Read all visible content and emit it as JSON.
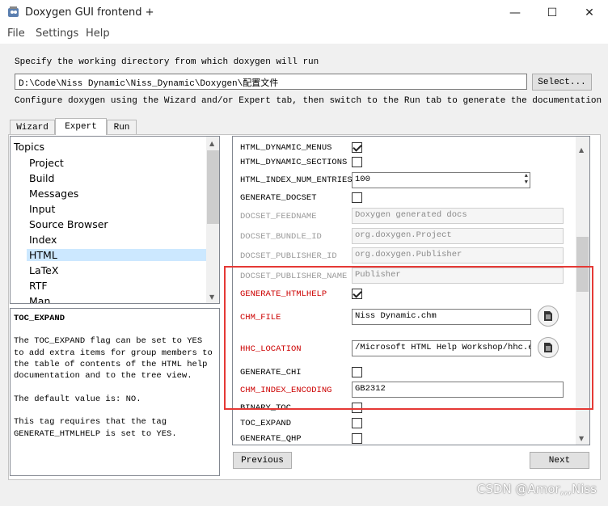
{
  "window": {
    "title": "Doxygen GUI frontend +",
    "minimize_glyph": "—",
    "maximize_glyph": "☐",
    "close_glyph": "✕"
  },
  "menu": [
    "File",
    "Settings",
    "Help"
  ],
  "workdir": {
    "label": "Specify the working directory from which doxygen will run",
    "path": "D:\\Code\\Niss Dynamic\\Niss_Dynamic\\Doxygen\\配置文件",
    "select_label": "Select..."
  },
  "configure_hint": "Configure doxygen using the Wizard and/or Expert tab, then switch to the Run tab to generate the documentation",
  "tabs": [
    "Wizard",
    "Expert",
    "Run"
  ],
  "topics": {
    "header": "Topics",
    "items": [
      "Project",
      "Build",
      "Messages",
      "Input",
      "Source Browser",
      "Index",
      "HTML",
      "LaTeX",
      "RTF",
      "Man"
    ],
    "selected": "HTML"
  },
  "help": {
    "title": "TOC_EXPAND",
    "body": "The TOC_EXPAND flag can be set to YES\nto add extra items for group members to\nthe table of contents of the HTML help\ndocumentation and to the tree view.\n\nThe default value is: NO.\n\nThis tag requires that the tag\nGENERATE_HTMLHELP is set to YES."
  },
  "settings": {
    "html_dynamic_menus": {
      "label": "HTML_DYNAMIC_MENUS",
      "checked": true
    },
    "html_dynamic_sections": {
      "label": "HTML_DYNAMIC_SECTIONS",
      "checked": false
    },
    "html_index_num_entries": {
      "label": "HTML_INDEX_NUM_ENTRIES",
      "value": "100"
    },
    "generate_docset": {
      "label": "GENERATE_DOCSET",
      "checked": false
    },
    "docset_feedname": {
      "label": "DOCSET_FEEDNAME",
      "value": "Doxygen generated docs"
    },
    "docset_bundle_id": {
      "label": "DOCSET_BUNDLE_ID",
      "value": "org.doxygen.Project"
    },
    "docset_publisher_id": {
      "label": "DOCSET_PUBLISHER_ID",
      "value": "org.doxygen.Publisher"
    },
    "docset_publisher_name": {
      "label": "DOCSET_PUBLISHER_NAME",
      "value": "Publisher"
    },
    "generate_htmlhelp": {
      "label": "GENERATE_HTMLHELP",
      "checked": true
    },
    "chm_file": {
      "label": "CHM_FILE",
      "value": "Niss Dynamic.chm"
    },
    "hhc_location": {
      "label": "HHC_LOCATION",
      "value": "/Microsoft HTML Help Workshop/hhc.exe"
    },
    "generate_chi": {
      "label": "GENERATE_CHI",
      "checked": false
    },
    "chm_index_encoding": {
      "label": "CHM_INDEX_ENCODING",
      "value": "GB2312"
    },
    "binary_toc": {
      "label": "BINARY_TOC",
      "checked": false
    },
    "toc_expand": {
      "label": "TOC_EXPAND",
      "checked": false
    },
    "generate_qhp": {
      "label": "GENERATE_QHP",
      "checked": false
    }
  },
  "buttons": {
    "previous": "Previous",
    "next": "Next"
  },
  "watermark": "CSDN @Amor,,,Niss",
  "colors": {
    "highlight_box": "#e53935",
    "changed_option": "#cc0000"
  }
}
